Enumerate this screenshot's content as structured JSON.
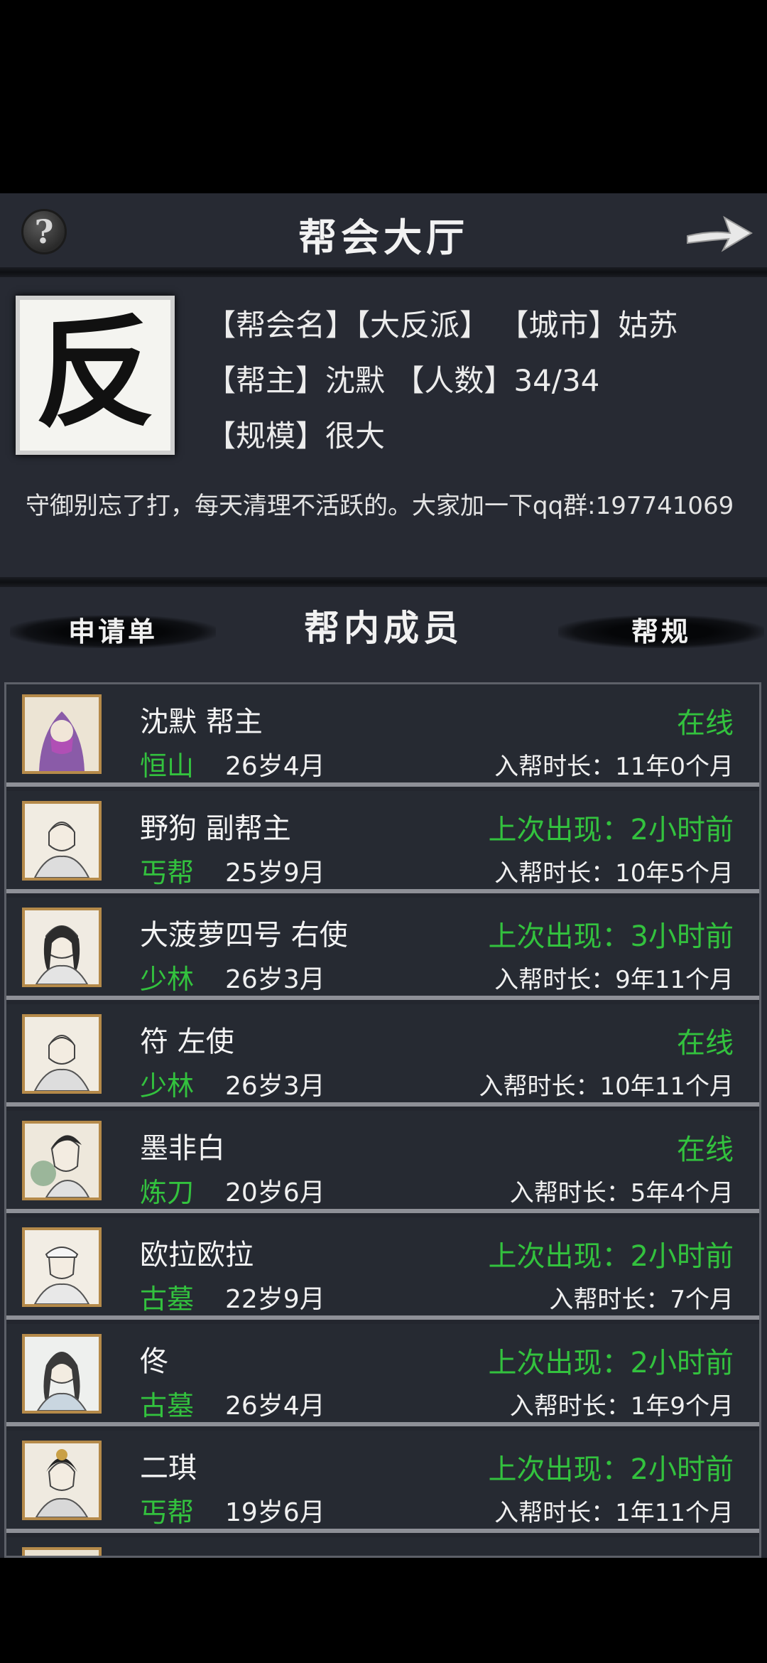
{
  "header": {
    "help_label": "?",
    "title": "帮会大厅",
    "back_icon": "arrow-right-icon"
  },
  "guild": {
    "emblem_char": "反",
    "line1": "【帮会名】【大反派】 【城市】姑苏",
    "line2": "【帮主】沈默 【人数】34/34",
    "line3": "【规模】很大",
    "notice": "守御别忘了打，每天清理不活跃的。大家加一下qq群:197741069"
  },
  "tabs": {
    "applications": "申请单",
    "members_title": "帮内成员",
    "rules": "帮规"
  },
  "colors": {
    "green": "#33c23e",
    "panel": "#272a33",
    "row": "#262a32"
  },
  "members": [
    {
      "name": "沈默 帮主",
      "sect": "恒山",
      "age": "26岁4月",
      "status": "在线",
      "tenure": "入帮时长：11年0个月"
    },
    {
      "name": "野狗 副帮主",
      "sect": "丐帮",
      "age": "25岁9月",
      "status": "上次出现：2小时前",
      "tenure": "入帮时长：10年5个月"
    },
    {
      "name": "大菠萝四号 右使",
      "sect": "少林",
      "age": "26岁3月",
      "status": "上次出现：3小时前",
      "tenure": "入帮时长：9年11个月"
    },
    {
      "name": "符 左使",
      "sect": "少林",
      "age": "26岁3月",
      "status": "在线",
      "tenure": "入帮时长：10年11个月"
    },
    {
      "name": "墨非白",
      "sect": "炼刀",
      "age": "20岁6月",
      "status": "在线",
      "tenure": "入帮时长：5年4个月"
    },
    {
      "name": "欧拉欧拉",
      "sect": "古墓",
      "age": "22岁9月",
      "status": "上次出现：2小时前",
      "tenure": "入帮时长：7个月"
    },
    {
      "name": "佟",
      "sect": "古墓",
      "age": "26岁4月",
      "status": "上次出现：2小时前",
      "tenure": "入帮时长：1年9个月"
    },
    {
      "name": "二琪",
      "sect": "丐帮",
      "age": "19岁6月",
      "status": "上次出现：2小时前",
      "tenure": "入帮时长：1年11个月"
    }
  ]
}
